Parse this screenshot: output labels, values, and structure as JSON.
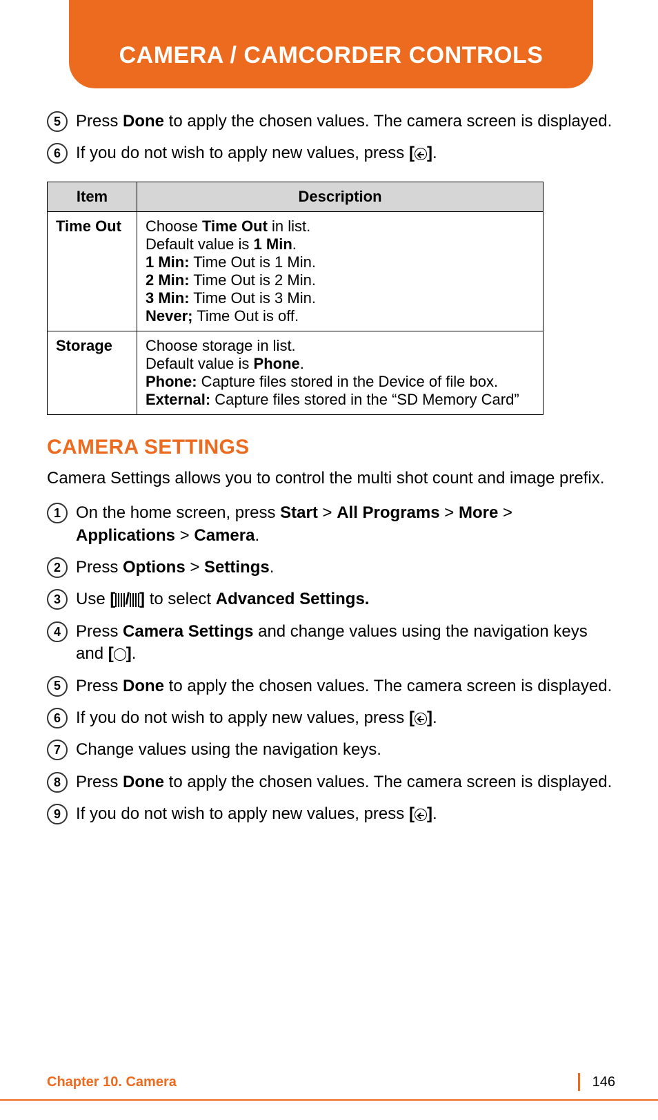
{
  "header": {
    "title": "CAMERA / CAMCORDER CONTROLS"
  },
  "top_steps": [
    {
      "num": "5",
      "parts": [
        {
          "t": "Press "
        },
        {
          "t": "Done",
          "b": true
        },
        {
          "t": " to apply the chosen values. The camera screen is displayed."
        }
      ]
    },
    {
      "num": "6",
      "parts": [
        {
          "t": "If you do not wish to apply new values, press "
        },
        {
          "t": "[",
          "b": true
        },
        {
          "icon": "back"
        },
        {
          "t": "]",
          "b": true
        },
        {
          "t": "."
        }
      ]
    }
  ],
  "table": {
    "headers": [
      "Item",
      "Description"
    ],
    "rows": [
      {
        "item": "Time Out",
        "lines": [
          [
            {
              "t": "Choose "
            },
            {
              "t": "Time Out",
              "b": true
            },
            {
              "t": " in list."
            }
          ],
          [
            {
              "t": "Default value is "
            },
            {
              "t": "1 Min",
              "b": true
            },
            {
              "t": "."
            }
          ],
          [
            {
              "t": "1 Min:",
              "b": true
            },
            {
              "t": " Time Out is 1 Min."
            }
          ],
          [
            {
              "t": "2 Min:",
              "b": true
            },
            {
              "t": " Time Out is 2 Min."
            }
          ],
          [
            {
              "t": "3 Min:",
              "b": true
            },
            {
              "t": " Time Out is 3 Min."
            }
          ],
          [
            {
              "t": "Never;",
              "b": true
            },
            {
              "t": " Time Out is off."
            }
          ]
        ]
      },
      {
        "item": "Storage",
        "lines": [
          [
            {
              "t": "Choose storage in list."
            }
          ],
          [
            {
              "t": "Default value is "
            },
            {
              "t": "Phone",
              "b": true
            },
            {
              "t": "."
            }
          ],
          [
            {
              "t": "Phone:",
              "b": true
            },
            {
              "t": " Capture files stored in the Device of file box."
            }
          ],
          [
            {
              "t": "External:",
              "b": true
            },
            {
              "t": " Capture files stored in the “SD Memory Card”"
            }
          ]
        ]
      }
    ]
  },
  "section": {
    "heading": "CAMERA SETTINGS",
    "intro": "Camera Settings allows you to control the multi shot count and image prefix.",
    "steps": [
      {
        "num": "1",
        "parts": [
          {
            "t": "On the home screen, press "
          },
          {
            "t": "Start",
            "b": true
          },
          {
            "t": " > "
          },
          {
            "t": "All Programs",
            "b": true
          },
          {
            "t": " > "
          },
          {
            "t": "More",
            "b": true
          },
          {
            "t": " > "
          },
          {
            "t": "Applications",
            "b": true
          },
          {
            "t": " > "
          },
          {
            "t": "Camera",
            "b": true
          },
          {
            "t": "."
          }
        ]
      },
      {
        "num": "2",
        "parts": [
          {
            "t": "Press "
          },
          {
            "t": "Options",
            "b": true
          },
          {
            "t": " > "
          },
          {
            "t": "Settings",
            "b": true
          },
          {
            "t": "."
          }
        ]
      },
      {
        "num": "3",
        "parts": [
          {
            "t": "Use "
          },
          {
            "t": "[",
            "b": true
          },
          {
            "icon": "scroll"
          },
          {
            "t": "/",
            "b": true
          },
          {
            "icon": "scroll"
          },
          {
            "t": "]",
            "b": true
          },
          {
            "t": " to select "
          },
          {
            "t": "Advanced Settings.",
            "b": true
          }
        ]
      },
      {
        "num": "4",
        "parts": [
          {
            "t": "Press "
          },
          {
            "t": "Camera Settings",
            "b": true
          },
          {
            "t": " and change values using the navigation keys and "
          },
          {
            "t": "[",
            "b": true
          },
          {
            "icon": "circle"
          },
          {
            "t": "]",
            "b": true
          },
          {
            "t": "."
          }
        ]
      },
      {
        "num": "5",
        "parts": [
          {
            "t": "Press "
          },
          {
            "t": "Done",
            "b": true
          },
          {
            "t": " to apply the chosen values. The camera screen is displayed."
          }
        ]
      },
      {
        "num": "6",
        "parts": [
          {
            "t": "If you do not wish to apply new values, press "
          },
          {
            "t": "[",
            "b": true
          },
          {
            "icon": "back"
          },
          {
            "t": "]",
            "b": true
          },
          {
            "t": "."
          }
        ]
      },
      {
        "num": "7",
        "parts": [
          {
            "t": "Change values using the navigation keys."
          }
        ]
      },
      {
        "num": "8",
        "parts": [
          {
            "t": "Press "
          },
          {
            "t": "Done",
            "b": true
          },
          {
            "t": " to apply the chosen values. The camera screen is displayed."
          }
        ]
      },
      {
        "num": "9",
        "parts": [
          {
            "t": "If you do not wish to apply new values, press "
          },
          {
            "t": "[",
            "b": true
          },
          {
            "icon": "back"
          },
          {
            "t": "]",
            "b": true
          },
          {
            "t": "."
          }
        ]
      }
    ]
  },
  "footer": {
    "chapter": "Chapter 10. Camera",
    "page": "146"
  }
}
